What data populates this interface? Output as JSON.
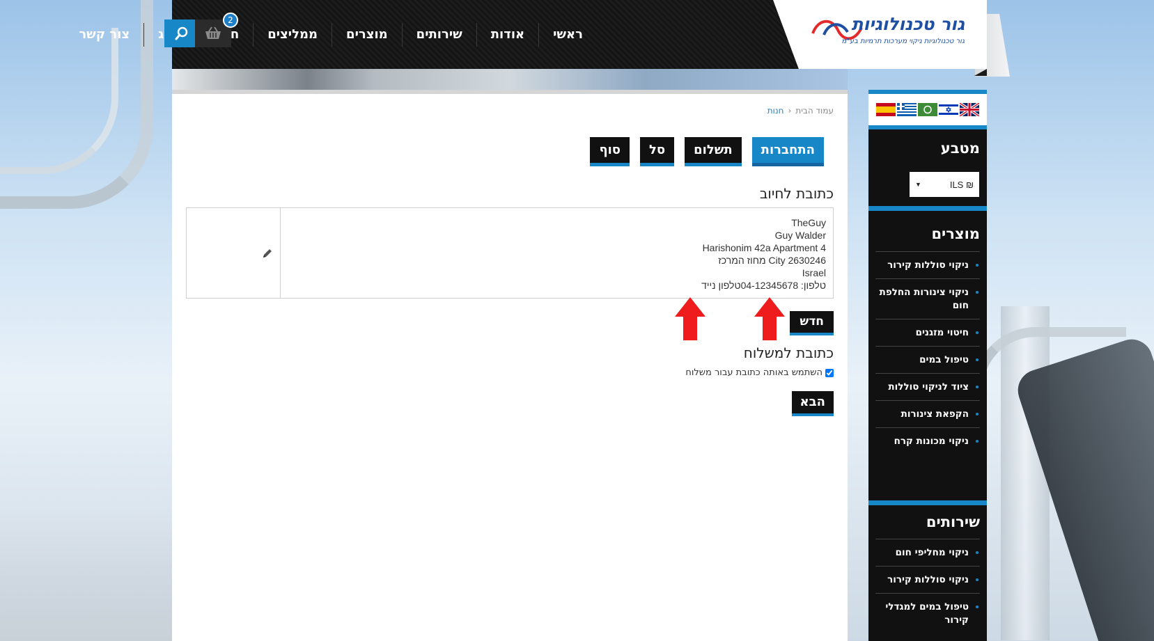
{
  "brand": {
    "title": "גור טכנולוגיות",
    "subtitle": "גור טכנולוגיות ניקוי מערכות תרמיות בע\"מ",
    "colors": {
      "accent": "#1787c8",
      "logo_blue": "#1e4fa3",
      "logo_red": "#e32b2b",
      "nav_bg": "#141414"
    }
  },
  "nav": {
    "items": [
      "ראשי",
      "אודות",
      "שירותים",
      "מוצרים",
      "ממליצים",
      "חנות",
      "בלוג",
      "צור קשר"
    ]
  },
  "cart": {
    "count": "2",
    "icon": "basket-icon"
  },
  "search": {
    "icon": "search-icon"
  },
  "breadcrumb": {
    "home": "עמוד הבית",
    "current": "חנות"
  },
  "steps": {
    "items": [
      "התחברות",
      "תשלום",
      "סל",
      "סוף"
    ],
    "active_index": 0
  },
  "billing": {
    "title": "כתובת לחיוב",
    "address": {
      "line1": "TheGuy",
      "line2": "Guy Walder",
      "line3": "Harishonim 42a Apartment 4",
      "line4": "מחוז המרכז City 2630246",
      "line5": "Israel",
      "line6": "טלפון: 04-12345678טלפון נייד"
    },
    "edit_icon": "pencil-icon",
    "new_label": "חדש"
  },
  "shipping": {
    "title": "כתובת למשלוח",
    "same_address_label": "השתמש באותה כתובת עבור משלוח",
    "same_address_checked": true
  },
  "next_label": "הבא",
  "sidebar": {
    "languages": [
      "english-flag",
      "israel-flag",
      "arabic-flag",
      "greece-flag",
      "spain-flag"
    ],
    "currency_title": "מטבע",
    "currency_value": "ILS ₪",
    "products_title": "מוצרים",
    "products": [
      "ניקוי סוללות קירור",
      "ניקוי צינורות החלפת חום",
      "חיטוי מזגנים",
      "טיפול במים",
      "ציוד לניקוי סוללות",
      "הקפאת צינורות",
      "ניקוי מכונות קרח"
    ],
    "services_title": "שירותים",
    "services": [
      "ניקוי מחליפי חום",
      "ניקוי סוללות קירור",
      "טיפול במים למגדלי קירור"
    ]
  }
}
